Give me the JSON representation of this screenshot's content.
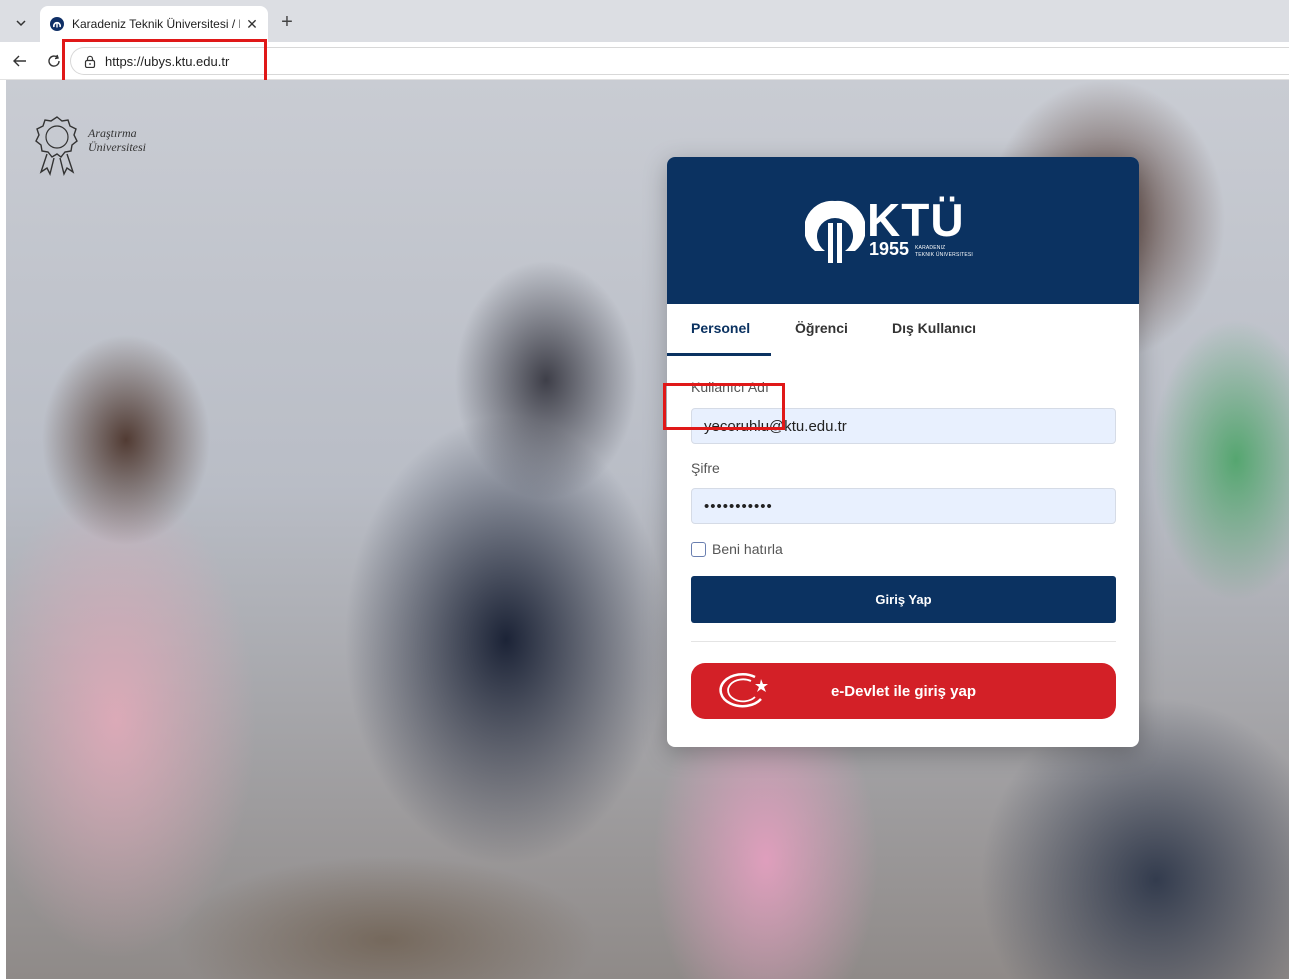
{
  "browser": {
    "tab_title": "Karadeniz Teknik Üniversitesi / Bilg",
    "tab_close": "✕",
    "new_tab": "+",
    "url": "https://ubys.ktu.edu.tr"
  },
  "badge": {
    "line1": "Araştırma",
    "line2": "Üniversitesi"
  },
  "logo": {
    "name": "KTÜ",
    "year": "1955",
    "sub1": "Karadeniz",
    "sub2": "Teknik Üniversitesi"
  },
  "tabs": [
    {
      "label": "Personel",
      "active": true
    },
    {
      "label": "Öğrenci",
      "active": false
    },
    {
      "label": "Dış Kullanıcı",
      "active": false
    }
  ],
  "form": {
    "username_label": "Kullanıcı Adı",
    "username_value": "yecoruhlu@ktu.edu.tr",
    "password_label": "Şifre",
    "password_value": "•••••••••••",
    "remember_label": "Beni hatırla",
    "remember_checked": false,
    "login_button": "Giriş Yap",
    "edevlet_button": "e-Devlet ile giriş yap"
  },
  "colors": {
    "brand_navy": "#0b3261",
    "edevlet_red": "#d32027",
    "highlight_red": "#e01818",
    "input_bg": "#e8f0fe"
  }
}
